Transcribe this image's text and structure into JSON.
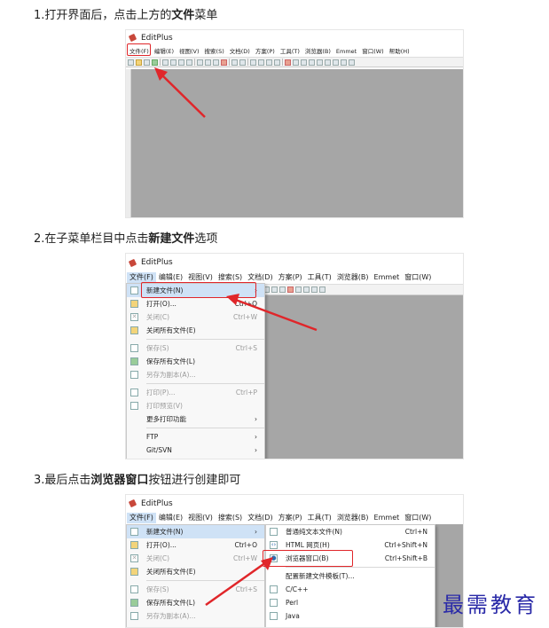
{
  "steps": {
    "step1_prefix": "1.打开界面后，点击上方的",
    "step1_bold": "文件",
    "step1_suffix": "菜单",
    "step2_prefix": "2.在子菜单栏目中点击",
    "step2_bold": "新建文件",
    "step2_suffix": "选项",
    "step3_prefix": "3.最后点击",
    "step3_bold": "浏览器窗口",
    "step3_suffix": "按钮进行创建即可"
  },
  "app": {
    "title": "EditPlus",
    "menu_small": [
      "文件(F)",
      "编辑(E)",
      "视图(V)",
      "搜索(S)",
      "文档(D)",
      "方案(P)",
      "工具(T)",
      "浏览器(B)",
      "Emmet",
      "窗口(W)",
      "帮助(H)"
    ],
    "menu": [
      "文件(F)",
      "编辑(E)",
      "视图(V)",
      "搜索(S)",
      "文档(D)",
      "方案(P)",
      "工具(T)",
      "浏览器(B)",
      "Emmet",
      "窗口(W)"
    ]
  },
  "file_menu": {
    "items": [
      {
        "label": "新建文件(N)",
        "shortcut": "",
        "arrow": "›"
      },
      {
        "label": "打开(O)...",
        "shortcut": "Ctrl+O",
        "arrow": ""
      },
      {
        "label": "关闭(C)",
        "shortcut": "Ctrl+W",
        "arrow": ""
      },
      {
        "label": "关闭所有文件(E)",
        "shortcut": "",
        "arrow": ""
      },
      {
        "label": "保存(S)",
        "shortcut": "Ctrl+S",
        "arrow": ""
      },
      {
        "label": "保存所有文件(L)",
        "shortcut": "",
        "arrow": ""
      },
      {
        "label": "另存为副本(A)...",
        "shortcut": "",
        "arrow": ""
      },
      {
        "label": "打印(P)...",
        "shortcut": "Ctrl+P",
        "arrow": ""
      },
      {
        "label": "打印预览(V)",
        "shortcut": "",
        "arrow": ""
      },
      {
        "label": "更多打印功能",
        "shortcut": "",
        "arrow": "›"
      },
      {
        "label": "FTP",
        "shortcut": "",
        "arrow": "›"
      },
      {
        "label": "Git/SVN",
        "shortcut": "",
        "arrow": "›"
      }
    ]
  },
  "new_submenu": {
    "items": [
      {
        "label": "普通纯文本文件(N)",
        "shortcut": "Ctrl+N"
      },
      {
        "label": "HTML 网页(H)",
        "shortcut": "Ctrl+Shift+N"
      },
      {
        "label": "浏览器窗口(B)",
        "shortcut": "Ctrl+Shift+B"
      },
      {
        "label": "配置新建文件模板(T)...",
        "shortcut": ""
      },
      {
        "label": "C/C++",
        "shortcut": ""
      },
      {
        "label": "Perl",
        "shortcut": ""
      },
      {
        "label": "Java",
        "shortcut": ""
      }
    ]
  },
  "watermark": "最需教育",
  "colors": {
    "highlight_box": "#e0262a",
    "workarea": "#a6a6a6",
    "menu_highlight": "#cfe2f6"
  }
}
